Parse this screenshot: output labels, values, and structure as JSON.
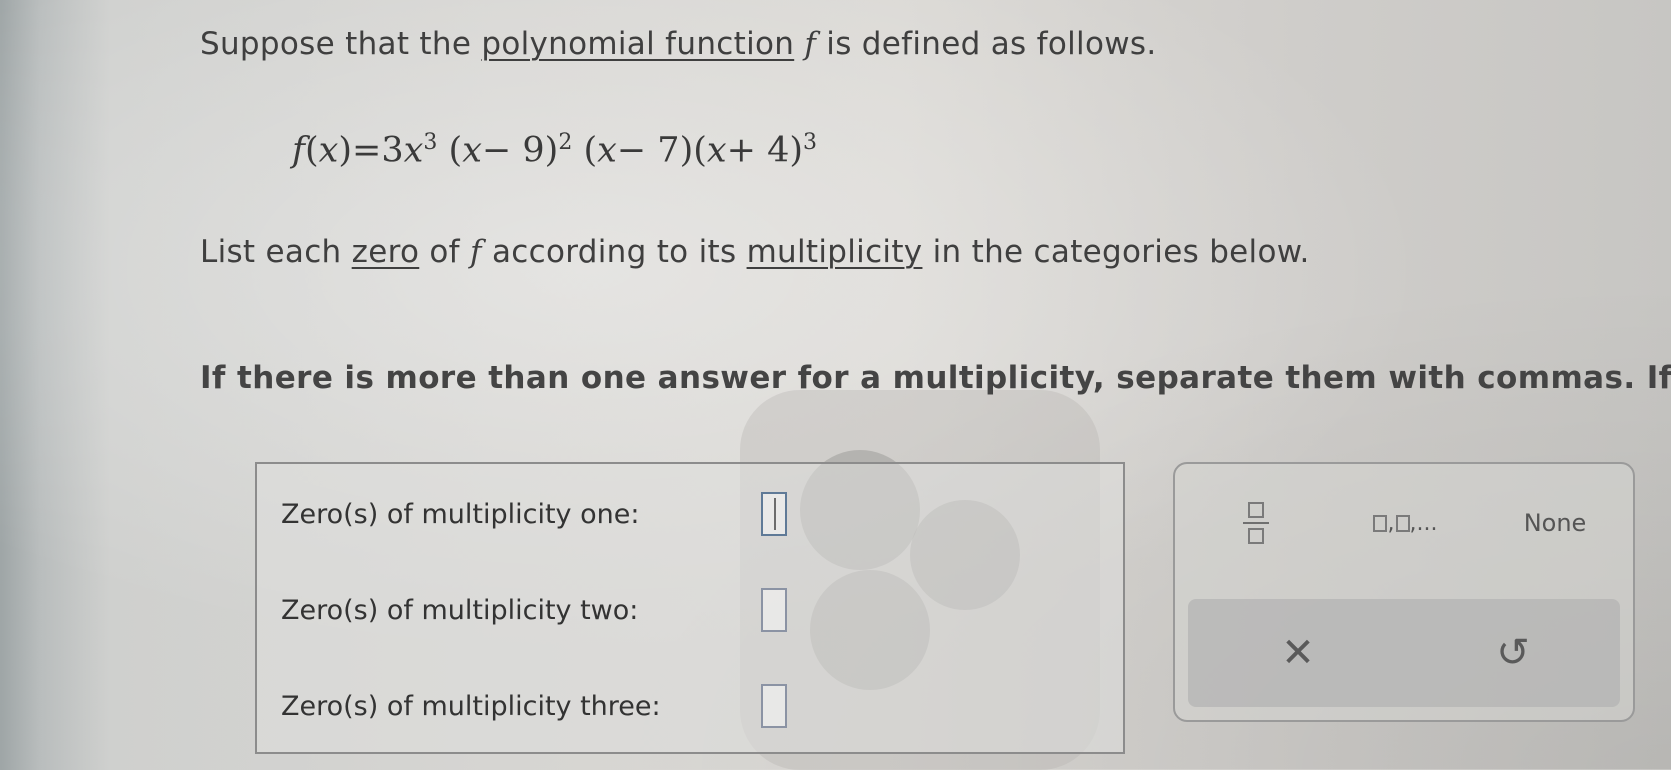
{
  "problem": {
    "intro_before": "Suppose that the ",
    "intro_term": "polynomial function",
    "intro_var": "f",
    "intro_after": " is defined as follows.",
    "equation": {
      "lhs_f": "f",
      "lhs_paren_open": "(",
      "lhs_x": "x",
      "lhs_paren_close": ")",
      "equals": "=3",
      "term1_var": "x",
      "term1_exp": "3",
      "term2_open": "(",
      "term2_var": "x",
      "term2_rest": "− 9)",
      "term2_exp": "2",
      "term3_open": "(",
      "term3_var": "x",
      "term3_rest": "− 7)",
      "term4_open": "(",
      "term4_var": "x",
      "term4_rest": "+ 4)",
      "term4_exp": "3"
    },
    "instruction_before": "List each ",
    "instruction_term1": "zero",
    "instruction_mid1": " of ",
    "instruction_var": "f",
    "instruction_mid2": " according to its ",
    "instruction_term2": "multiplicity",
    "instruction_after": " in the categories below.",
    "note": "If there is more than one answer for a multiplicity, separate them with commas. If th"
  },
  "answers": [
    {
      "label": "Zero(s) of multiplicity one:",
      "value": ""
    },
    {
      "label": "Zero(s) of multiplicity two:",
      "value": ""
    },
    {
      "label": "Zero(s) of multiplicity three:",
      "value": ""
    }
  ],
  "keypad": {
    "list_sep": ",",
    "list_ellipsis": ",...",
    "none_label": "None",
    "clear_glyph": "✕",
    "undo_glyph": "↺"
  },
  "colors": {
    "text": "#3f3f3f",
    "input_border": "#8b93a4",
    "box_border": "#8c8c8c"
  }
}
